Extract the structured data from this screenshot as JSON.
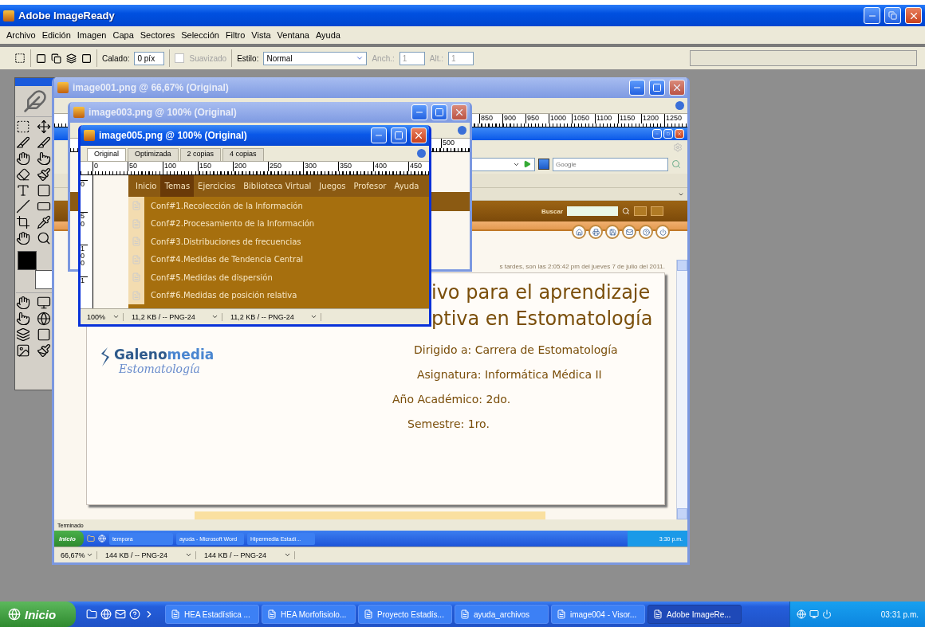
{
  "app": {
    "title": "Adobe ImageReady"
  },
  "menu": [
    "Archivo",
    "Edición",
    "Imagen",
    "Capa",
    "Sectores",
    "Selección",
    "Filtro",
    "Vista",
    "Ventana",
    "Ayuda"
  ],
  "options": {
    "feather_label": "Calado:",
    "feather_value": "0 píx",
    "antialias": {
      "label": "Suavizado",
      "checked": false,
      "disabled": true
    },
    "style_label": "Estilo:",
    "style_value": "Normal",
    "width": {
      "label": "Anch.:",
      "value": "1",
      "disabled": true
    },
    "height": {
      "label": "Alt.:",
      "value": "1",
      "disabled": true
    }
  },
  "documents": [
    {
      "kind": "browser",
      "title": "image001.png @ 66,67% (Original)",
      "active": false,
      "ruler": [
        "850",
        "900",
        "950",
        "1000",
        "1050",
        "1100",
        "1150",
        "1200",
        "1250"
      ],
      "status": {
        "zoom": "66,67%",
        "sizes": [
          "144 KB / -- PNG-24",
          "144 KB / -- PNG-24"
        ]
      }
    },
    {
      "kind": "page",
      "title": "image003.png @ 100% (Original)",
      "active": false,
      "ruler": [
        "500"
      ]
    },
    {
      "kind": "menu_page",
      "title": "image005.png @ 100% (Original)",
      "active": true,
      "tabs": [
        {
          "label": "Original",
          "selected": true
        },
        {
          "label": "Optimizada",
          "selected": false
        },
        {
          "label": "2 copias",
          "selected": false
        },
        {
          "label": "4 copias",
          "selected": false
        }
      ],
      "ruler": [
        "0",
        "50",
        "100",
        "150",
        "200",
        "250",
        "300",
        "350",
        "400",
        "450"
      ],
      "vruler": [
        "0",
        "50",
        "100",
        "1"
      ],
      "status": {
        "zoom": "100%",
        "sizes": [
          "11,2 KB / -- PNG-24",
          "11,2 KB / -- PNG-24"
        ]
      }
    }
  ],
  "browser": {
    "search_placeholder": "Google",
    "search_label": "Buscar",
    "status_line": "s tardes, son las 2:05:42 pm del jueves 7 de julio del 2011.",
    "heading": [
      "ivo para el aprendizaje",
      "ptiva en Estomatología"
    ],
    "logo": {
      "name": "Galeno",
      "accent": "media",
      "subtitle": "Estomatología"
    },
    "lines": [
      "Dirigido a: Carrera de Estomatología",
      "Asignatura: Informática Médica II",
      "Año Académico: 2do.",
      "Semestre: 1ro."
    ],
    "status": "Terminado",
    "taskbar": {
      "start": "Inicio",
      "tasks": [
        "tempora",
        "ayuda - Microsoft Word",
        "Hipermedia Estadí..."
      ],
      "clock": "3:30 p.m."
    }
  },
  "site_menu": {
    "items": [
      {
        "label": "Inicio",
        "selected": false
      },
      {
        "label": "Temas",
        "selected": true
      },
      {
        "label": "Ejercicios",
        "selected": false
      },
      {
        "label": "Biblioteca Virtual",
        "selected": false
      },
      {
        "label": "Juegos",
        "selected": false
      },
      {
        "label": "Profesor",
        "selected": false
      },
      {
        "label": "Ayuda",
        "selected": false
      }
    ],
    "dropdown": [
      "Conf#1.Recolección de la Información",
      "Conf#2.Procesamiento de la Información",
      "Conf#3.Distribuciones de frecuencias",
      "Conf#4.Medidas de Tendencia Central",
      "Conf#5.Medidas de dispersión",
      "Conf#6.Medidas de posición relativa"
    ]
  },
  "taskbar": {
    "start": "Inicio",
    "tasks": [
      {
        "label": "HEA Estadística ...",
        "selected": false
      },
      {
        "label": "HEA Morfofisiolo...",
        "selected": false
      },
      {
        "label": "Proyecto Estadís...",
        "selected": false
      },
      {
        "label": "ayuda_archivos",
        "selected": false
      },
      {
        "label": "image004 - Visor...",
        "selected": false
      },
      {
        "label": "Adobe ImageRe...",
        "selected": true
      }
    ],
    "clock": "03:31 p.m."
  }
}
